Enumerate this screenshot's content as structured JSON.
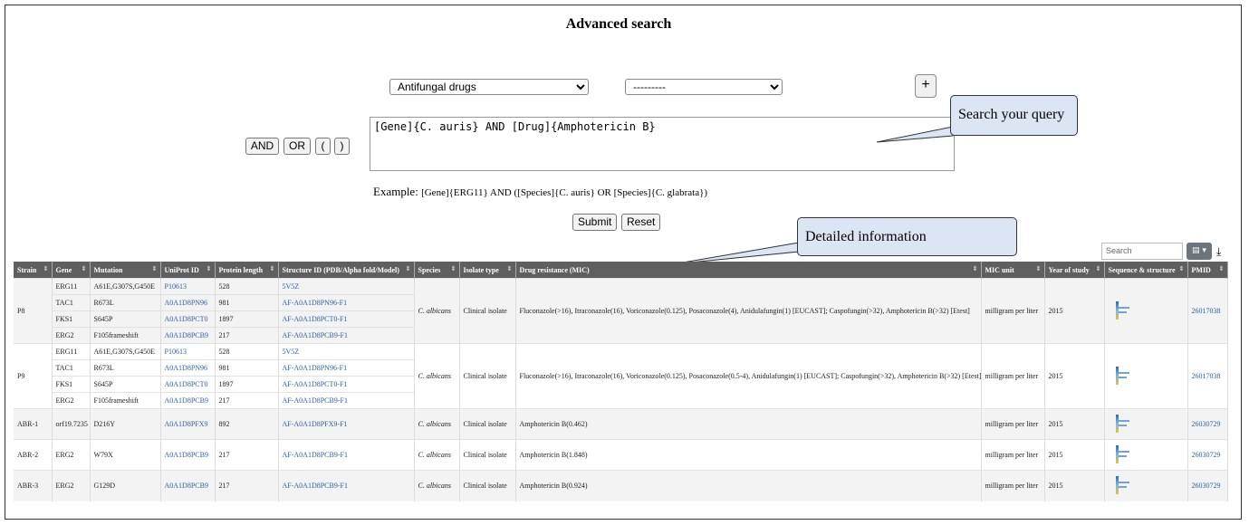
{
  "page": {
    "title": "Advanced search"
  },
  "search": {
    "field_select": "Antifungal drugs",
    "value_select": "---------",
    "add_button": "+",
    "query": "[Gene]{C. auris} AND [Drug]{Amphotericin B}",
    "operators": [
      "AND",
      "OR",
      "(",
      ")"
    ],
    "example_label": "Example:",
    "example_text": "[Gene]{ERG11} AND ([Species]{C. auris} OR [Species]{C. glabrata})",
    "submit_label": "Submit",
    "reset_label": "Reset"
  },
  "callouts": {
    "query": "Search your query",
    "detail": "Detailed information"
  },
  "table_tools": {
    "search_placeholder": "Search",
    "columns_icon": "grid-icon",
    "download_icon": "download-icon"
  },
  "table": {
    "headers": [
      "Strain",
      "Gene",
      "Mutation",
      "UniProt ID",
      "Protein length",
      "Structure ID (PDB/Alpha fold/Model)",
      "Species",
      "Isolate type",
      "Drug resistance (MIC)",
      "MIC unit",
      "Year of study",
      "Sequence & structure",
      "PMID"
    ],
    "groups": [
      {
        "strain": "P8",
        "genes": [
          {
            "gene": "ERG11",
            "mutation": "A61E,G307S,G450E",
            "uniprot": "P10613",
            "length": "528",
            "structure": "5V5Z"
          },
          {
            "gene": "TAC1",
            "mutation": "R673L",
            "uniprot": "A0A1D8PN96",
            "length": "981",
            "structure": "AF-A0A1D8PN96-F1"
          },
          {
            "gene": "FKS1",
            "mutation": "S645P",
            "uniprot": "A0A1D8PCT0",
            "length": "1897",
            "structure": "AF-A0A1D8PCT0-F1"
          },
          {
            "gene": "ERG2",
            "mutation": "F105frameshift",
            "uniprot": "A0A1D8PCB9",
            "length": "217",
            "structure": "AF-A0A1D8PCB9-F1"
          }
        ],
        "species": "C. albicans",
        "isolate": "Clinical isolate",
        "drug": "Fluconazole(>16), Itraconazole(16), Voriconazole(0.125), Posaconazole(4), Anidulafungin(1) [EUCAST]; Caspofungin(>32), Amphotericin B(>32) [Etest]",
        "unit": "milligram per liter",
        "year": "2015",
        "pmid": "26017038"
      },
      {
        "strain": "P9",
        "genes": [
          {
            "gene": "ERG11",
            "mutation": "A61E,G307S,G450E",
            "uniprot": "P10613",
            "length": "528",
            "structure": "5V5Z"
          },
          {
            "gene": "TAC1",
            "mutation": "R673L",
            "uniprot": "A0A1D8PN96",
            "length": "981",
            "structure": "AF-A0A1D8PN96-F1"
          },
          {
            "gene": "FKS1",
            "mutation": "S645P",
            "uniprot": "A0A1D8PCT0",
            "length": "1897",
            "structure": "AF-A0A1D8PCT0-F1"
          },
          {
            "gene": "ERG2",
            "mutation": "F105frameshift",
            "uniprot": "A0A1D8PCB9",
            "length": "217",
            "structure": "AF-A0A1D8PCB9-F1"
          }
        ],
        "species": "C. albicans",
        "isolate": "Clinical isolate",
        "drug": "Fluconazole(>16), Itraconazole(16), Voriconazole(0.125), Posaconazole(0.5-4), Anidulafungin(1) [EUCAST]; Caspofungin(>32), Amphotericin B(>32) [Etest]",
        "unit": "milligram per liter",
        "year": "2015",
        "pmid": "26017038"
      },
      {
        "strain": "ABR-1",
        "genes": [
          {
            "gene": "orf19.7235",
            "mutation": "D216Y",
            "uniprot": "A0A1D8PFX9",
            "length": "892",
            "structure": "AF-A0A1D8PFX9-F1"
          }
        ],
        "species": "C. albicans",
        "isolate": "Clinical isolate",
        "drug": "Amphotericin B(0.462)",
        "unit": "milligram per liter",
        "year": "2015",
        "pmid": "26030729"
      },
      {
        "strain": "ABR-2",
        "genes": [
          {
            "gene": "ERG2",
            "mutation": "W79X",
            "uniprot": "A0A1D8PCB9",
            "length": "217",
            "structure": "AF-A0A1D8PCB9-F1"
          }
        ],
        "species": "C. albicans",
        "isolate": "Clinical isolate",
        "drug": "Amphotericin B(1.848)",
        "unit": "milligram per liter",
        "year": "2015",
        "pmid": "26030729"
      },
      {
        "strain": "ABR-3",
        "genes": [
          {
            "gene": "ERG2",
            "mutation": "G129D",
            "uniprot": "A0A1D8PCB9",
            "length": "217",
            "structure": "AF-A0A1D8PCB9-F1"
          }
        ],
        "species": "C. albicans",
        "isolate": "Clinical isolate",
        "drug": "Amphotericin B(0.924)",
        "unit": "milligram per liter",
        "year": "2015",
        "pmid": "26030729"
      }
    ]
  }
}
